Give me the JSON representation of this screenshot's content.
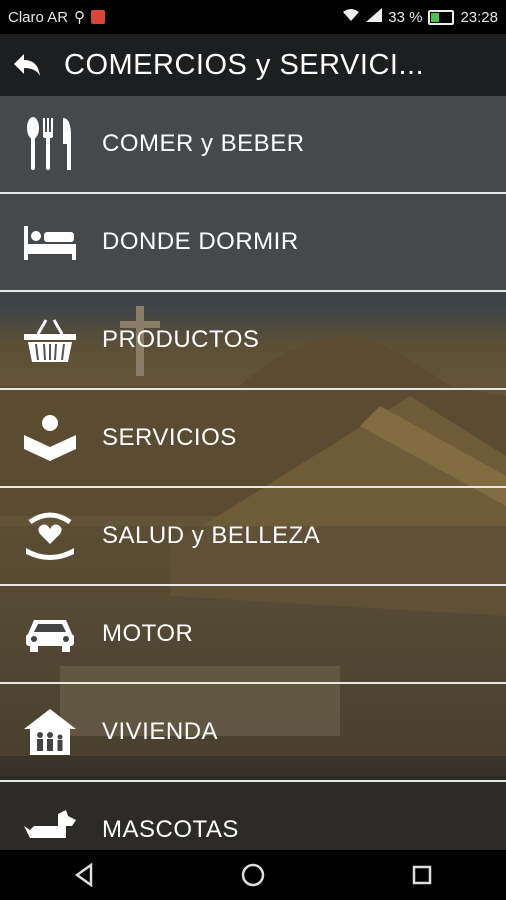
{
  "status_bar": {
    "carrier": "Claro AR",
    "battery_percent": "33 %",
    "time": "23:28",
    "battery_level": 0.33
  },
  "header": {
    "title": "COMERCIOS y SERVICI..."
  },
  "menu": [
    {
      "label": "COMER y BEBER",
      "icon": "utensils-icon"
    },
    {
      "label": "DONDE DORMIR",
      "icon": "bed-icon"
    },
    {
      "label": "PRODUCTOS",
      "icon": "basket-icon"
    },
    {
      "label": "SERVICIOS",
      "icon": "hand-person-icon"
    },
    {
      "label": "SALUD y BELLEZA",
      "icon": "heart-hands-icon"
    },
    {
      "label": "MOTOR",
      "icon": "car-icon"
    },
    {
      "label": "VIVIENDA",
      "icon": "house-icon"
    },
    {
      "label": "MASCOTAS",
      "icon": "dog-icon"
    }
  ],
  "navigation": [
    "back",
    "home",
    "recents"
  ]
}
